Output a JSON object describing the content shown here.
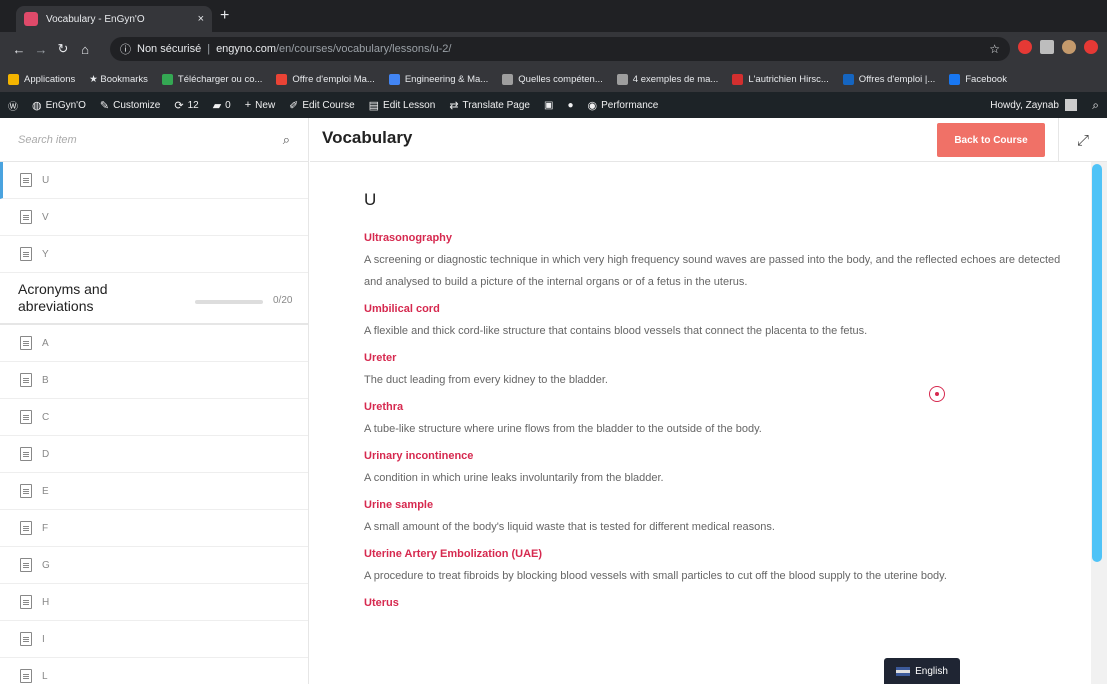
{
  "browser": {
    "tab_title": "Vocabulary - EnGyn'O",
    "tab_close": "×",
    "new_tab": "+",
    "omnibox_info": "ⓘ",
    "security_label": "Non sécurisé",
    "url_host": "engyno.com",
    "url_path": "/en/courses/vocabulary/lessons/u-2/"
  },
  "bookmarks": [
    {
      "label": "Applications",
      "color": "#f4b400"
    },
    {
      "label": "★ Bookmarks",
      "color": ""
    },
    {
      "label": "Télécharger ou co...",
      "color": "#34a853"
    },
    {
      "label": "Offre d'emploi Ma...",
      "color": "#ea4335"
    },
    {
      "label": "Engineering & Ma...",
      "color": "#4285f4"
    },
    {
      "label": "Quelles compéten...",
      "color": "#9e9e9e"
    },
    {
      "label": "4 exemples de ma...",
      "color": "#9e9e9e"
    },
    {
      "label": "L'autrichien Hirsc...",
      "color": "#d32f2f"
    },
    {
      "label": "Offres d'emploi |...",
      "color": "#1565c0"
    },
    {
      "label": "Facebook",
      "color": "#1877f2"
    }
  ],
  "wpbar": {
    "site": "EnGyn'O",
    "customize": "Customize",
    "updates": "12",
    "comments": "0",
    "new": "New",
    "edit_course": "Edit Course",
    "edit_lesson": "Edit Lesson",
    "translate": "Translate Page",
    "performance": "Performance",
    "howdy": "Howdy, Zaynab"
  },
  "sidebar": {
    "search_placeholder": "Search item",
    "top_lessons": [
      "U",
      "V",
      "Y"
    ],
    "section_title": "Acronyms and abreviations",
    "section_progress": "0/20",
    "section_lessons": [
      "A",
      "B",
      "C",
      "D",
      "E",
      "F",
      "G",
      "H",
      "I",
      "L"
    ]
  },
  "header": {
    "title": "Vocabulary",
    "back_label": "Back to Course"
  },
  "content": {
    "letter": "U",
    "entries": [
      {
        "term": "Ultrasonography",
        "definition": "A screening or diagnostic technique in which very high frequency sound waves are passed into the body, and the reflected echoes are detected and analysed to build a picture of the internal organs or of a fetus in the uterus."
      },
      {
        "term": "Umbilical cord",
        "definition": "A flexible and thick cord-like structure that contains blood vessels that connect the placenta to the fetus."
      },
      {
        "term": "Ureter",
        "definition": "The duct leading from every kidney to the bladder."
      },
      {
        "term": "Urethra",
        "definition": "A tube-like structure where urine flows from the bladder to the outside of the body."
      },
      {
        "term": "Urinary incontinence",
        "definition": "A condition in which urine leaks involuntarily from the bladder."
      },
      {
        "term": "Urine sample",
        "definition": "A small amount of the body's liquid waste that is tested for different medical reasons."
      },
      {
        "term": "Uterine Artery Embolization (UAE)",
        "definition": "A procedure to treat fibroids by blocking blood vessels with small particles to cut off the blood supply to the uterine body."
      },
      {
        "term": "Uterus",
        "definition": ""
      }
    ]
  },
  "language": "English"
}
